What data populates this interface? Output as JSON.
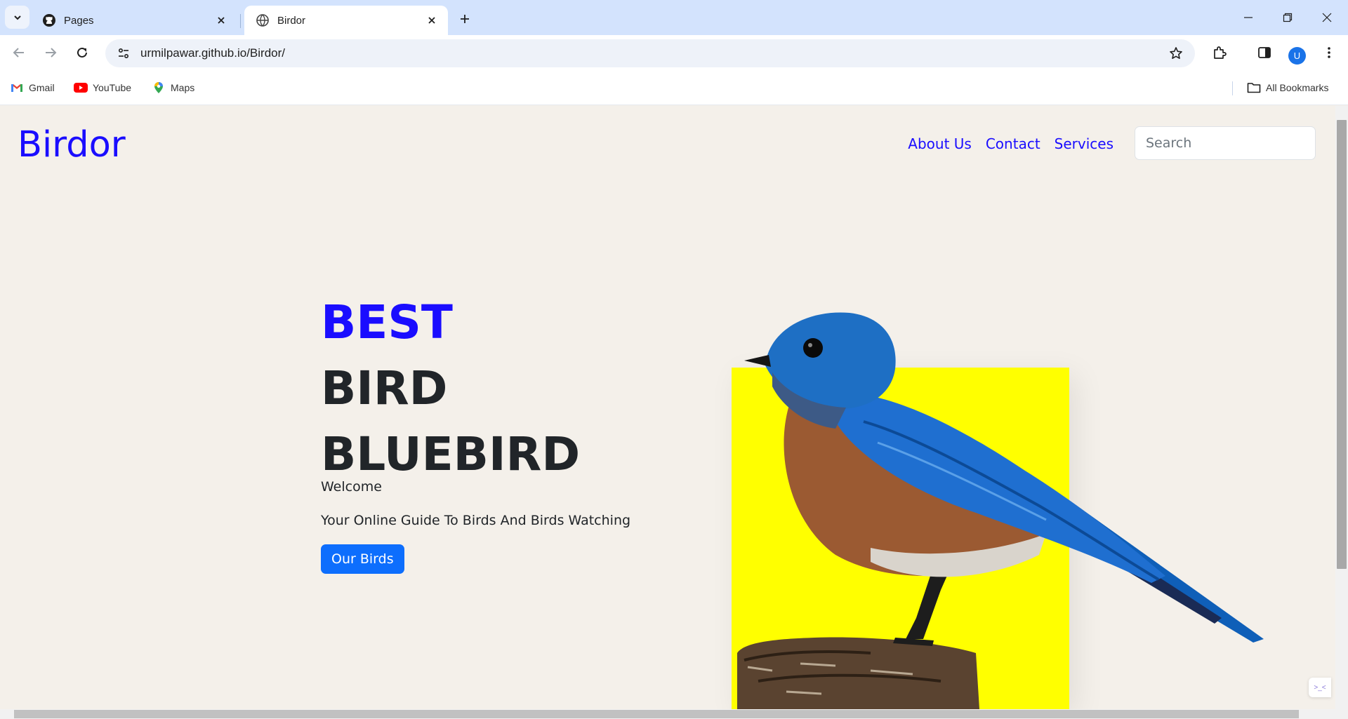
{
  "browser": {
    "tabs": [
      {
        "title": "Pages",
        "icon": "github-icon",
        "active": false
      },
      {
        "title": "Birdor",
        "icon": "globe-icon",
        "active": true
      }
    ],
    "url": "urmilpawar.github.io/Birdor/",
    "avatar_letter": "U",
    "bookmarks": [
      {
        "label": "Gmail",
        "icon": "gmail-icon"
      },
      {
        "label": "YouTube",
        "icon": "youtube-icon"
      },
      {
        "label": "Maps",
        "icon": "maps-icon"
      }
    ],
    "all_bookmarks_label": "All Bookmarks"
  },
  "page": {
    "brand": "Birdor",
    "nav": [
      "About Us",
      "Contact",
      "Services"
    ],
    "search_placeholder": "Search",
    "hero": {
      "line1": "BEST",
      "line2": "BIRD",
      "line3": "BLUEBIRD",
      "welcome": "Welcome",
      "tagline": "Your Online Guide To Birds And Birds Watching",
      "cta": "Our Birds"
    },
    "colors": {
      "brand_blue": "#1a0dff",
      "button_blue": "#0d6efd",
      "page_bg": "#f4f0ea",
      "accent_yellow": "#ffff00"
    }
  }
}
